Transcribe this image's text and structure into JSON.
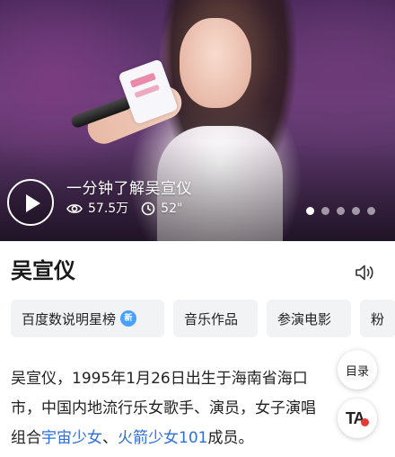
{
  "hero": {
    "title": "一分钟了解吴宣仪",
    "views": "57.5万",
    "duration": "52\"",
    "slides_total": 5,
    "active_slide": 1
  },
  "entry": {
    "title": "吴宣仪"
  },
  "tabs": [
    {
      "label": "百度数说明星榜",
      "badge": "新"
    },
    {
      "label": "音乐作品"
    },
    {
      "label": "参演电影"
    },
    {
      "label": "粉"
    }
  ],
  "summary": {
    "line1": "吴宣仪，1995年1月26日出生于海南省海口",
    "line2": "市，中国内地流行乐女歌手、演员，女子演唱",
    "line3_prefix": "组合",
    "link1": "宇宙少女",
    "sep": "、",
    "link2": "火箭少女101",
    "line3_suffix": "成员。"
  },
  "floating": {
    "toc_label": "目录",
    "ta_label": "TA"
  },
  "colors": {
    "link": "#2f6fdb",
    "badge": "#4aa0ff",
    "ta_dot": "#e53935"
  }
}
